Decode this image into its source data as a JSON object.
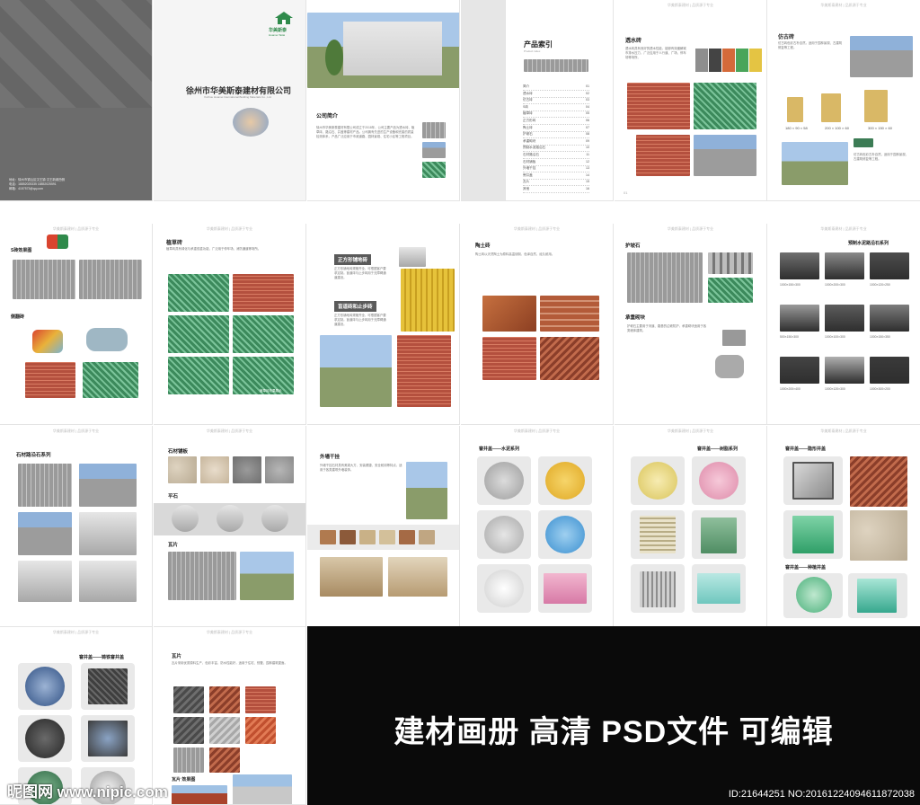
{
  "company": {
    "name_cn": "徐州市华美斯泰建材有限公司",
    "name_en": "Xuzhou Huamei International Building Materials Co., Ltd.",
    "logo_text": "华美斯泰",
    "logo_sub": "Huamei Taitai",
    "contact_lines": [
      "地址：徐州市铜山区汉王镇 汉王新城西侧",
      "电话：18852025335  18852025591",
      "邮箱：4157573@qq.com"
    ]
  },
  "intro": {
    "heading": "公司简介",
    "body": "徐州市华美斯泰建材有限公司成立于2018年，公司主要产品为透水砖、植草砖、路沿石、井盖等建材产品。公司拥有先进的生产设备和完善的质量检测体系，产品广泛应用于市政道路、园林景观、住宅小区等工程项目。"
  },
  "index": {
    "title": "产品索引",
    "subtitle": "Product index",
    "items": [
      {
        "name": "简介",
        "page": "01"
      },
      {
        "name": "透水砖",
        "page": "02"
      },
      {
        "name": "仿古砖",
        "page": "03"
      },
      {
        "name": "S砖",
        "page": "04"
      },
      {
        "name": "植草砖",
        "page": "05"
      },
      {
        "name": "正方形砖",
        "page": "06"
      },
      {
        "name": "陶土砖",
        "page": "07"
      },
      {
        "name": "护坡石",
        "page": "08"
      },
      {
        "name": "承重砌块",
        "page": "09"
      },
      {
        "name": "预制水泥路沿石",
        "page": "10"
      },
      {
        "name": "石材路沿石",
        "page": "11"
      },
      {
        "name": "石材铺板",
        "page": "12"
      },
      {
        "name": "外墙干挂",
        "page": "13"
      },
      {
        "name": "窨井盖",
        "page": "14"
      },
      {
        "name": "瓦片",
        "page": "15"
      },
      {
        "name": "其他",
        "page": "16"
      }
    ]
  },
  "pages": {
    "permeable": {
      "title": "透水砖",
      "text": "透水砖具有良好的透水性能，能够有效缓解城市排水压力，广泛应用于人行道、广场、停车场等场所。"
    },
    "antique": {
      "title": "仿古砖",
      "text": "仿古砖色彩古朴自然，适用于园林景观、古建筑修复等工程。",
      "sizes": [
        "180 × 90 × 58",
        "200 × 100 × 60",
        "300 × 150 × 60"
      ]
    },
    "s_brick": {
      "title": "S砖效果图",
      "sub": "侧翻砖"
    },
    "grass": {
      "title": "植草砖",
      "text": "植草砖具有绿化与承重双重功能，广泛用于停车场、消防通道等场所。",
      "label": "植草砖效果展示"
    },
    "square": {
      "title": "正方形铺地砖",
      "sub": "盲道砖和止步砖",
      "text": "正方形铺地砖规格齐全，可根据客户要求定制。盲道砖与止步砖用于无障碍通道建设。"
    },
    "clay": {
      "title": "陶土砖",
      "text": "陶土砖以天然陶土为原料高温烧制，色泽自然、经久耐用。"
    },
    "slope": {
      "title": "护坡石",
      "sub": "承重砌块",
      "text": "护坡石主要用于河道、路基的边坡防护，承重砌块适用于各类墙体建筑。"
    },
    "curb": {
      "title": "预制水泥路沿石系列",
      "sizes": [
        "1000×150×300",
        "1000×200×300",
        "1000×120×250",
        "500×150×300",
        "1000×100×300",
        "1000×150×350",
        "1000×200×400",
        "1000×120×300",
        "1000×300×200"
      ]
    },
    "stone_curb": {
      "title": "石材路沿石系列"
    },
    "stone_slab": {
      "title": "石材铺板",
      "sub": "平石",
      "sub2": "瓦片"
    },
    "wall": {
      "title": "外墙干挂",
      "text": "外墙干挂石材具有美观大方、安装便捷、安全耐用等特点，适用于各类建筑外墙装饰。"
    },
    "manhole_cement": {
      "title": "窨井盖——水泥系列"
    },
    "manhole_resin": {
      "title": "窨井盖——树脂系列"
    },
    "manhole_hidden": {
      "title": "窨井盖——隐形井盖",
      "sub": "窨井盖——种植井盖"
    },
    "manhole_iron": {
      "title": "窨井盖——铸铁窨井盖"
    },
    "tiles": {
      "title": "瓦片",
      "text": "瓦片采用优质原料生产，色彩丰富，防水性能好，适用于住宅、别墅、园林建筑屋面。",
      "sub": "瓦片 效果图"
    }
  },
  "header_strip": "华美斯泰建材  |  品质源于专业",
  "banner": {
    "title": "建材画册 高清 PSD文件 可编辑",
    "watermark_left": "昵图网 www.nipic.com",
    "watermark_right": "ID:21644251 NO:20161224094611872038"
  },
  "colors": {
    "brand_green": "#2f8a4b",
    "gray_panel": "#6c6c6c",
    "banner_bg": "#0a0a0a"
  }
}
